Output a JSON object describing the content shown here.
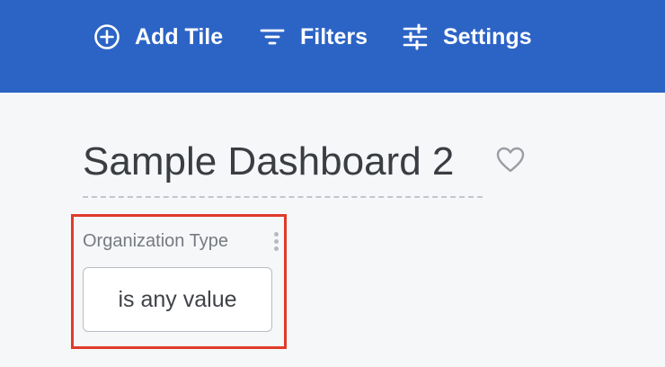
{
  "toolbar": {
    "background_color": "#2c64c6",
    "add_tile_label": "Add Tile",
    "filters_label": "Filters",
    "settings_label": "Settings",
    "icons": {
      "add_tile": "plus-circle-icon",
      "filters": "filter-lines-icon",
      "settings": "sliders-icon"
    }
  },
  "dashboard": {
    "title": "Sample Dashboard 2",
    "favorite_icon": "heart-outline-icon"
  },
  "filter": {
    "label": "Organization Type",
    "value": "is any value",
    "menu_icon": "kebab-menu-icon",
    "highlight_color": "#e03b2a"
  }
}
